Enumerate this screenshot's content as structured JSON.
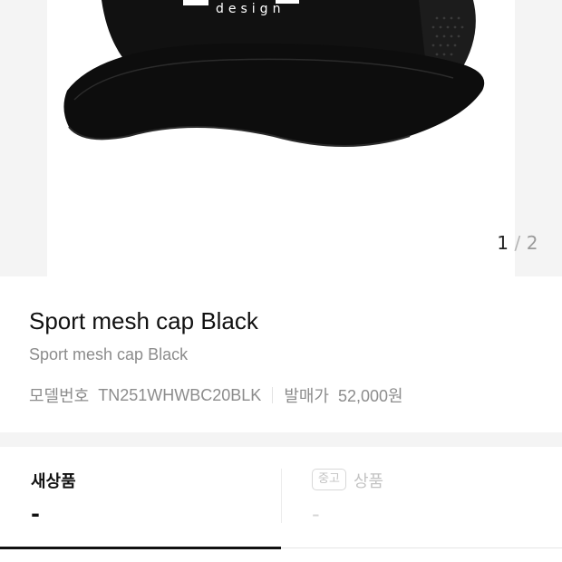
{
  "carousel": {
    "current": "1",
    "separator": "/",
    "total": "2",
    "image_text": "design"
  },
  "product": {
    "title": "Sport mesh cap Black",
    "subtitle": "Sport mesh cap Black",
    "model_label": "모델번호",
    "model_value": "TN251WHWBC20BLK",
    "release_label": "발매가",
    "release_value": "52,000원"
  },
  "tabs": {
    "new": {
      "label": "새상품",
      "price": "-"
    },
    "used": {
      "tag": "중고",
      "label": "상품",
      "price": "-"
    }
  },
  "colors": {
    "cap": "#111111",
    "accent": "#111111",
    "muted": "#8c8c8c"
  }
}
